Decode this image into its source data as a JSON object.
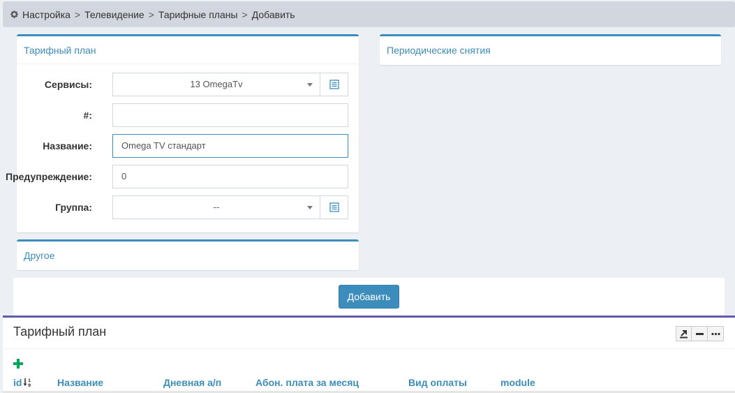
{
  "breadcrumb": {
    "items": [
      "Настройка",
      "Телевидение",
      "Тарифные планы",
      "Добавить"
    ],
    "separator": ">"
  },
  "tariff_box": {
    "title": "Тарифный план",
    "fields": {
      "services": {
        "label": "Сервисы:",
        "value": "13 OmegaTv"
      },
      "number": {
        "label": "#:",
        "value": ""
      },
      "name": {
        "label": "Название:",
        "value": "Omega TV стандарт"
      },
      "warning": {
        "label": "Предупреждение:",
        "value": "0"
      },
      "group": {
        "label": "Группа:",
        "value": "--"
      }
    }
  },
  "periodic_box": {
    "title": "Периодические снятия"
  },
  "other_box": {
    "title": "Другое"
  },
  "actions": {
    "add_label": "Добавить"
  },
  "table": {
    "title": "Тарифный план",
    "columns": [
      "id",
      "Название",
      "Дневная а/п",
      "Абон. плата за месяц",
      "Вид оплаты",
      "module"
    ]
  },
  "colors": {
    "primary": "#3c8dbc",
    "table_accent": "#605ca8",
    "add_green": "#00a65a"
  },
  "icons": {
    "breadcrumb": "gear-icon",
    "addon": "list-icon",
    "sort": "sort-numeric-desc-icon",
    "tools": [
      "export-icon",
      "minus-icon",
      "ellipsis-icon"
    ],
    "add": "plus-icon"
  }
}
